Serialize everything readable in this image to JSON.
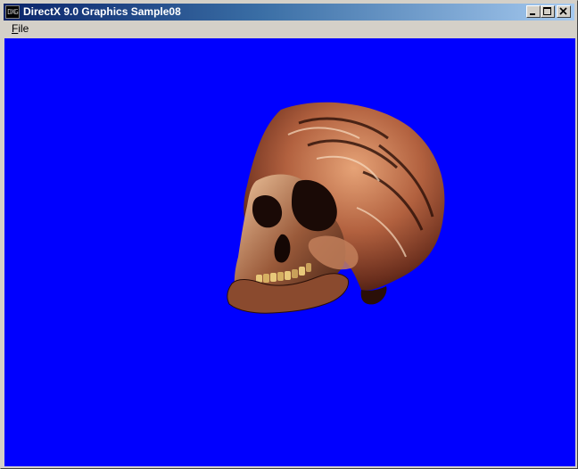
{
  "window": {
    "title": "DirectX 9.0 Graphics Sample08",
    "icon": {
      "name": "dxg-app-icon",
      "text": "DXG"
    }
  },
  "controls": {
    "minimize": "minimize-icon",
    "maximize": "maximize-icon",
    "close": "close-icon"
  },
  "menu": {
    "items": [
      {
        "label": "File",
        "accel": "F",
        "rest": "ile"
      }
    ]
  },
  "viewport": {
    "background": "#0000ff",
    "content": "rendered-3d-skull"
  },
  "colors": {
    "titlebar_start": "#0a246a",
    "titlebar_end": "#a6caf0",
    "chrome": "#d4d0c8"
  }
}
